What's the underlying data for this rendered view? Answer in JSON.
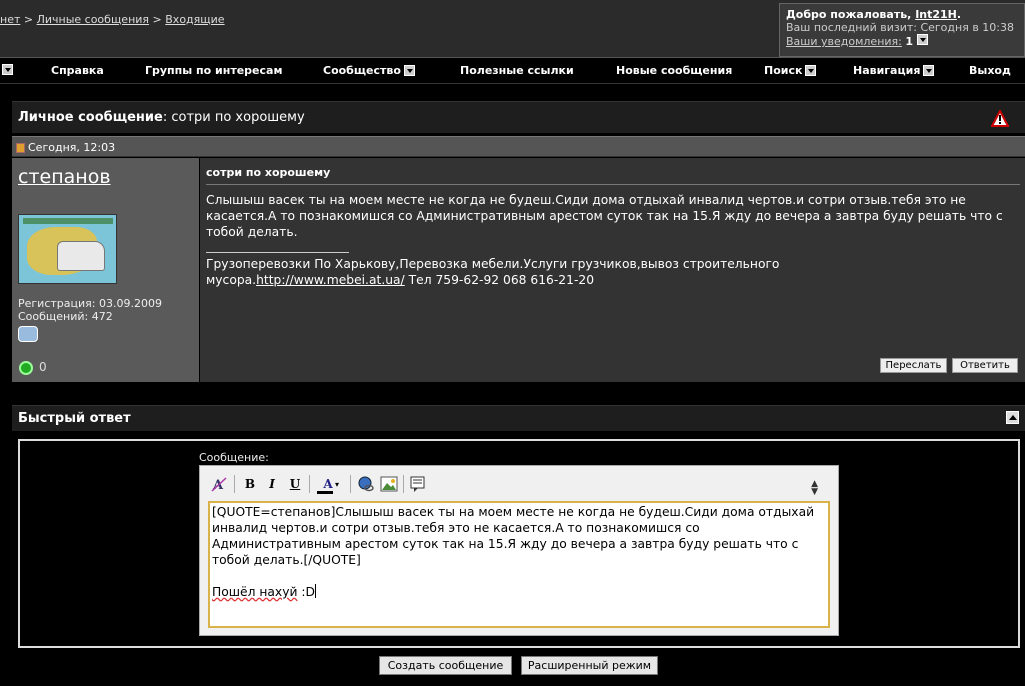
{
  "breadcrumb": {
    "items": [
      "нет",
      "Личные сообщения",
      "Входящие"
    ],
    "sep": ">"
  },
  "welcome": {
    "greeting": "Добро пожаловать,",
    "username": "Int21H",
    "last_visit_label": "Ваш последний визит:",
    "last_visit_value": "Сегодня в 10:38",
    "notifications_label": "Ваши уведомления:",
    "notifications_count": "1"
  },
  "nav": {
    "items": [
      "Справка",
      "Группы по интересам",
      "Сообщество",
      "Полезные ссылки",
      "Новые сообщения",
      "Поиск",
      "Навигация",
      "Выход"
    ]
  },
  "pm": {
    "header_label": "Личное сообщение",
    "header_title": ": сотри по хорошему",
    "date": "Сегодня, 12:03",
    "author": "степанов",
    "registration": "Регистрация: 03.09.2009",
    "messages": "Сообщений: 472",
    "status_char": "0",
    "title": "сотри по хорошему",
    "body": "Слышыш васек ты на моем месте не когда не будеш.Сиди дома отдыхай инвалид чертов.и сотри отзыв.тебя это не касается.А то познакомишся со Административным арестом суток так на 15.Я жду до вечера а завтра буду решать что с тобой делать.",
    "signature_text": "Грузоперевозки По Харькову,Перевозка мебели.Услуги грузчиков,вывоз строительного мусора.",
    "signature_link": "http://www.mebei.at.ua/",
    "signature_phone": " Тел 759-62-92 068 616-21-20",
    "forward_label": "Переслать",
    "reply_label": "Ответить"
  },
  "quick_reply": {
    "title": "Быстрый ответ",
    "message_label": "Сообщение:",
    "textarea_quote": "[QUOTE=степанов]Слышыш васек ты на моем месте не когда не будеш.Сиди дома отдыхай инвалид чертов.и сотри отзыв.тебя это не касается.А то познакомишся со Административным арестом суток так на 15.Я жду до вечера а завтра буду решать что с тобой делать.[/QUOTE]",
    "textarea_reply_underlined": "Пошёл нахуй",
    "textarea_reply_tail": " :D",
    "submit_label": "Создать сообщение",
    "advanced_label": "Расширенный режим"
  },
  "toolbar": {
    "bold": "B",
    "italic": "I",
    "underline": "U",
    "color": "A"
  }
}
